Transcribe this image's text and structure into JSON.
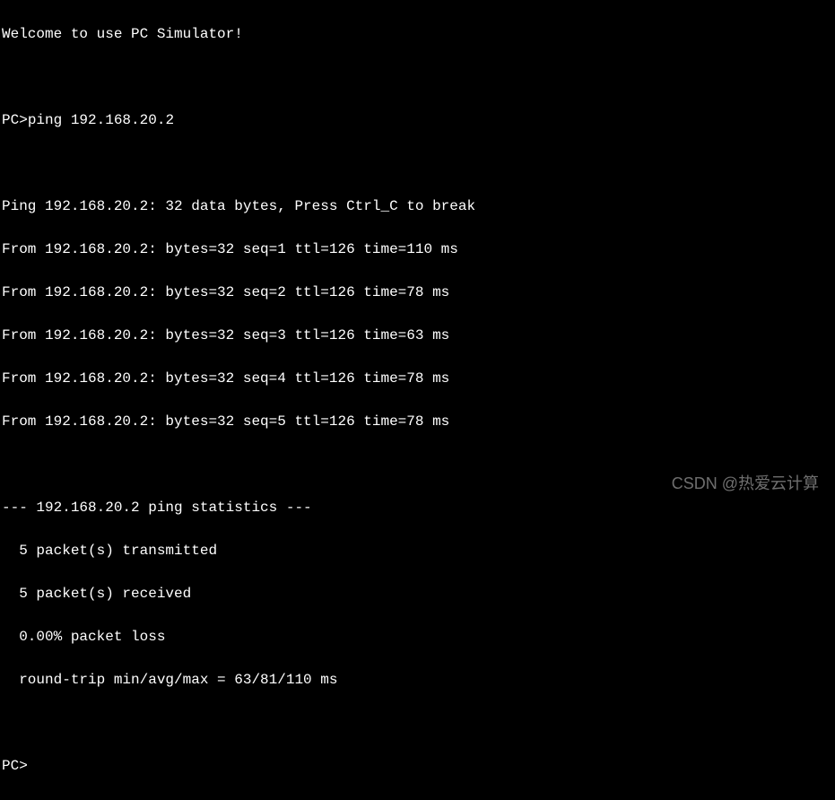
{
  "terminal": {
    "welcome": "Welcome to use PC Simulator!",
    "prompt1": "PC>",
    "command1": "ping 192.168.20.2",
    "ping_header": "Ping 192.168.20.2: 32 data bytes, Press Ctrl_C to break",
    "replies": [
      "From 192.168.20.2: bytes=32 seq=1 ttl=126 time=110 ms",
      "From 192.168.20.2: bytes=32 seq=2 ttl=126 time=78 ms",
      "From 192.168.20.2: bytes=32 seq=3 ttl=126 time=63 ms",
      "From 192.168.20.2: bytes=32 seq=4 ttl=126 time=78 ms",
      "From 192.168.20.2: bytes=32 seq=5 ttl=126 time=78 ms"
    ],
    "stats_header": "--- 192.168.20.2 ping statistics ---",
    "stats": [
      "  5 packet(s) transmitted",
      "  5 packet(s) received",
      "  0.00% packet loss",
      "  round-trip min/avg/max = 63/81/110 ms"
    ],
    "prompt2": "PC>"
  },
  "watermark": "CSDN @热爱云计算"
}
